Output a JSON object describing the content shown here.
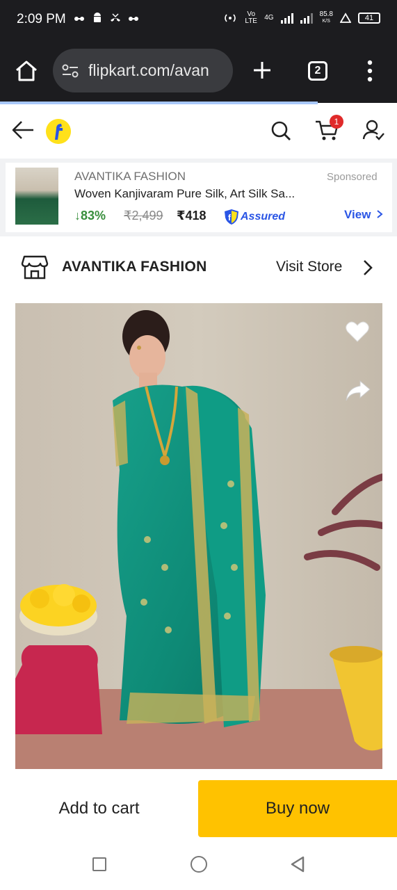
{
  "status_bar": {
    "time": "2:09 PM",
    "network_label": "Vo LTE",
    "network_gen": "4G",
    "speed_value": "85.8",
    "speed_unit": "K/S",
    "battery": "41"
  },
  "browser": {
    "url": "flipkart.com/avan",
    "tab_count": "2"
  },
  "header": {
    "cart_count": "1"
  },
  "ad": {
    "brand": "AVANTIKA FASHION",
    "sponsored_label": "Sponsored",
    "title": "Woven Kanjivaram Pure Silk, Art Silk Sa...",
    "discount": "↓83%",
    "mrp": "₹2,499",
    "price": "₹418",
    "assured_label": "Assured",
    "view_label": "View"
  },
  "store": {
    "name": "AVANTIKA FASHION",
    "visit_label": "Visit Store"
  },
  "actions": {
    "add_to_cart": "Add to cart",
    "buy_now": "Buy now"
  },
  "colors": {
    "flipkart_blue": "#2a55e5",
    "discount_green": "#388e3c",
    "buy_now_yellow": "#ffc200",
    "saree_teal": "#13917d"
  }
}
